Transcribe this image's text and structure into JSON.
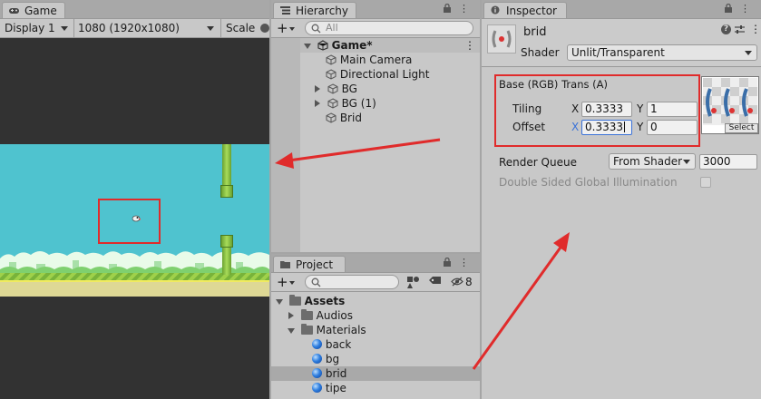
{
  "game": {
    "tab_label": "Game",
    "display": "Display 1",
    "resolution": "1080 (1920x1080)",
    "scale_label": "Scale"
  },
  "hierarchy": {
    "tab_label": "Hierarchy",
    "add_label": "+",
    "search_placeholder": "All",
    "root": "Game*",
    "items": [
      "Main Camera",
      "Directional Light",
      "BG",
      "BG (1)",
      "Brid"
    ]
  },
  "project": {
    "tab_label": "Project",
    "add_label": "+",
    "hidden_count": "8",
    "tree": {
      "assets": "Assets",
      "audios": "Audios",
      "materials": "Materials",
      "material_items": [
        "back",
        "bg",
        "brid",
        "tipe"
      ]
    },
    "selected": "brid"
  },
  "inspector": {
    "tab_label": "Inspector",
    "object_name": "brid",
    "shader_label": "Shader",
    "shader_value": "Unlit/Transparent",
    "texture_label": "Base (RGB) Trans (A)",
    "tiling_label": "Tiling",
    "offset_label": "Offset",
    "x_label": "X",
    "y_label": "Y",
    "tiling_x": "0.3333",
    "tiling_y": "1",
    "offset_x": "0.3333",
    "offset_y": "0",
    "select_label": "Select",
    "render_queue_label": "Render Queue",
    "render_queue_mode": "From Shader",
    "render_queue_value": "3000",
    "double_sided_label": "Double Sided Global Illumination"
  },
  "colors": {
    "annotation_red": "#e02b2b",
    "sky": "#4fc3cf",
    "pipe": "#8cc63f",
    "ground": "#ded895",
    "selection": "#3a72d8"
  }
}
